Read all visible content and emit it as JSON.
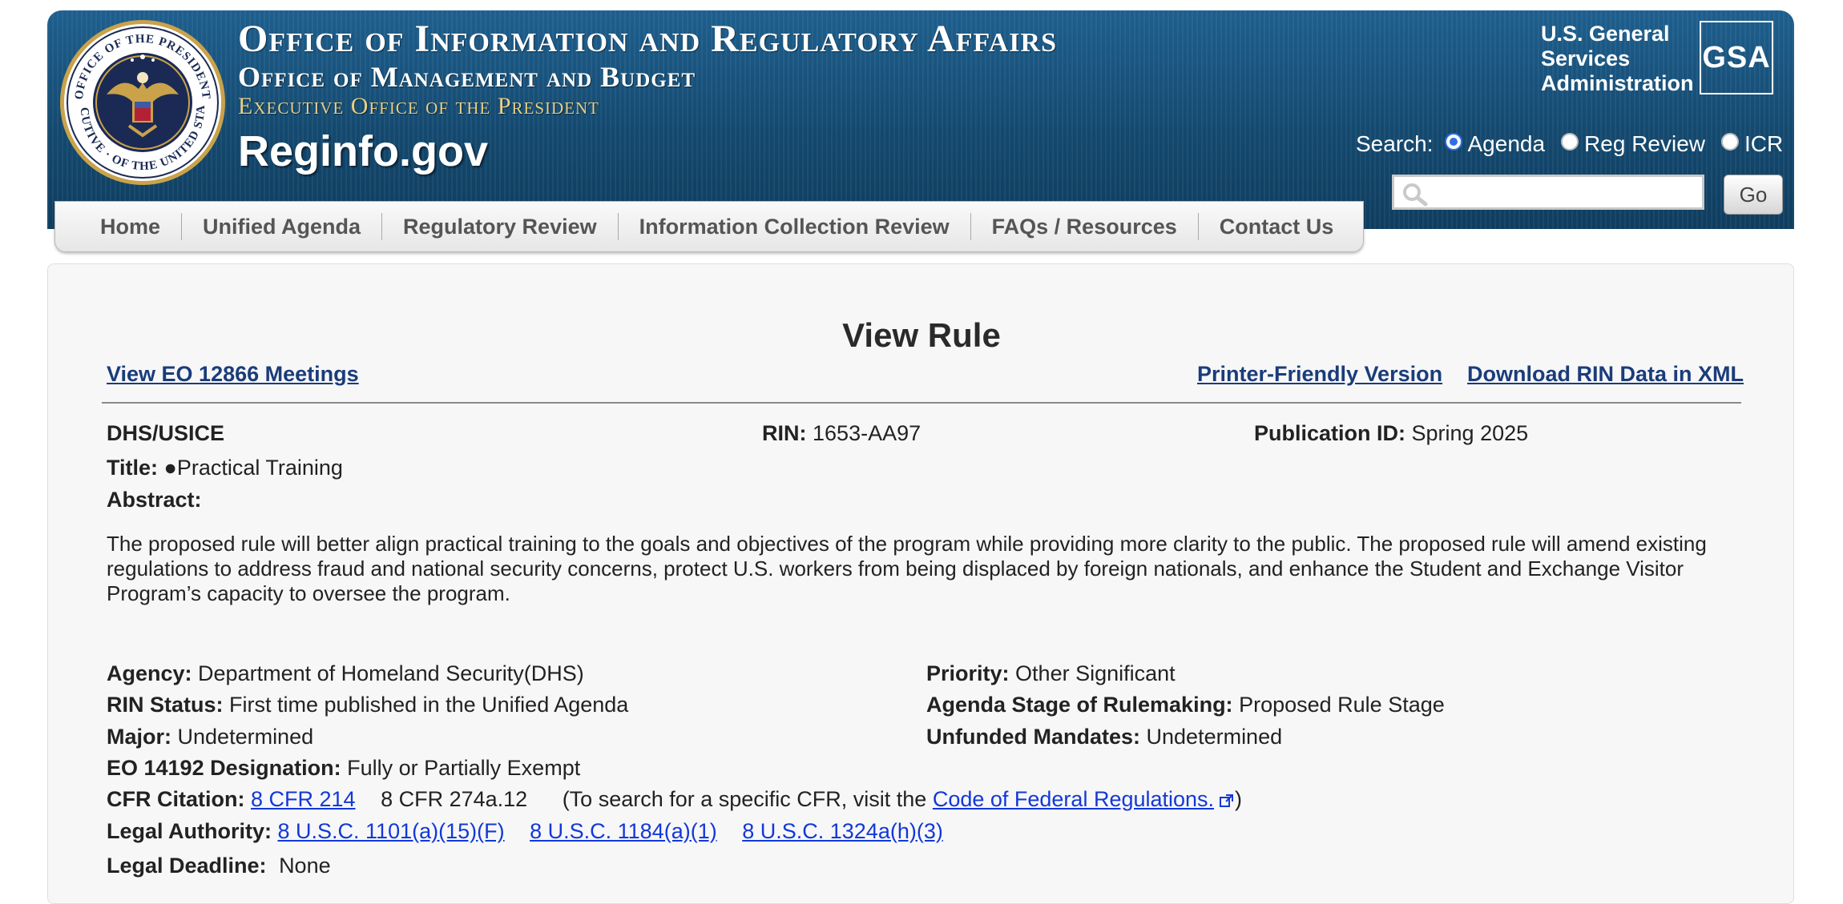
{
  "header": {
    "line1": "Office of Information and Regulatory Affairs",
    "line2": "Office of Management and Budget",
    "line3": "Executive Office of the President",
    "brand": "Reginfo.gov",
    "seal_top": "OFFICE OF THE PRESIDENT",
    "seal_bottom": "EXECUTIVE · OF THE UNITED STATES",
    "gsa_line1": "U.S. General",
    "gsa_line2": "Services",
    "gsa_line3": "Administration",
    "gsa_logo": "GSA"
  },
  "search": {
    "label": "Search:",
    "options": [
      "Agenda",
      "Reg Review",
      "ICR"
    ],
    "selected": "Agenda",
    "input_value": "",
    "go_label": "Go"
  },
  "nav": {
    "items": [
      "Home",
      "Unified Agenda",
      "Regulatory Review",
      "Information Collection Review",
      "FAQs / Resources",
      "Contact Us"
    ]
  },
  "page": {
    "title": "View Rule",
    "link_eo": "View EO 12866 Meetings",
    "link_printer": "Printer-Friendly Version",
    "link_xml": "Download RIN Data in XML"
  },
  "rule": {
    "agency_short": "DHS/USICE",
    "rin_label": "RIN:",
    "rin": "1653-AA97",
    "pub_label": "Publication ID:",
    "pub_id": "Spring 2025",
    "title_label": "Title:",
    "title": "●Practical Training",
    "abstract_label": "Abstract:",
    "abstract": "The proposed rule will better align practical training to the goals and objectives of the program while providing more clarity to the public. The proposed rule will amend existing regulations to address fraud and national security concerns, protect U.S. workers from being displaced by foreign nationals, and enhance the Student and Exchange Visitor Program’s capacity to oversee the program.",
    "agency_label": "Agency:",
    "agency": "Department of Homeland Security(DHS)",
    "priority_label": "Priority:",
    "priority": "Other Significant",
    "rin_status_label": "RIN Status:",
    "rin_status": "First time published in the Unified Agenda",
    "stage_label": "Agenda Stage of Rulemaking:",
    "stage": "Proposed Rule Stage",
    "major_label": "Major:",
    "major": "Undetermined",
    "unfunded_label": "Unfunded Mandates:",
    "unfunded": "Undetermined",
    "eo_label": "EO 14192 Designation:",
    "eo": "Fully or Partially Exempt",
    "cfr_label": "CFR Citation:",
    "cfr_link": "8 CFR 214",
    "cfr_plain": "8 CFR 274a.12",
    "cfr_note_pre": "(To search for a specific CFR, visit the ",
    "cfr_note_link": "Code of Federal Regulations.",
    "cfr_note_post": ")",
    "legal_auth_label": "Legal Authority:",
    "legal_auth": [
      "8 U.S.C. 1101(a)(15)(F)",
      "8 U.S.C. 1184(a)(1)",
      "8 U.S.C. 1324a(h)(3)"
    ],
    "deadline_label": "Legal Deadline:",
    "deadline": "None"
  }
}
